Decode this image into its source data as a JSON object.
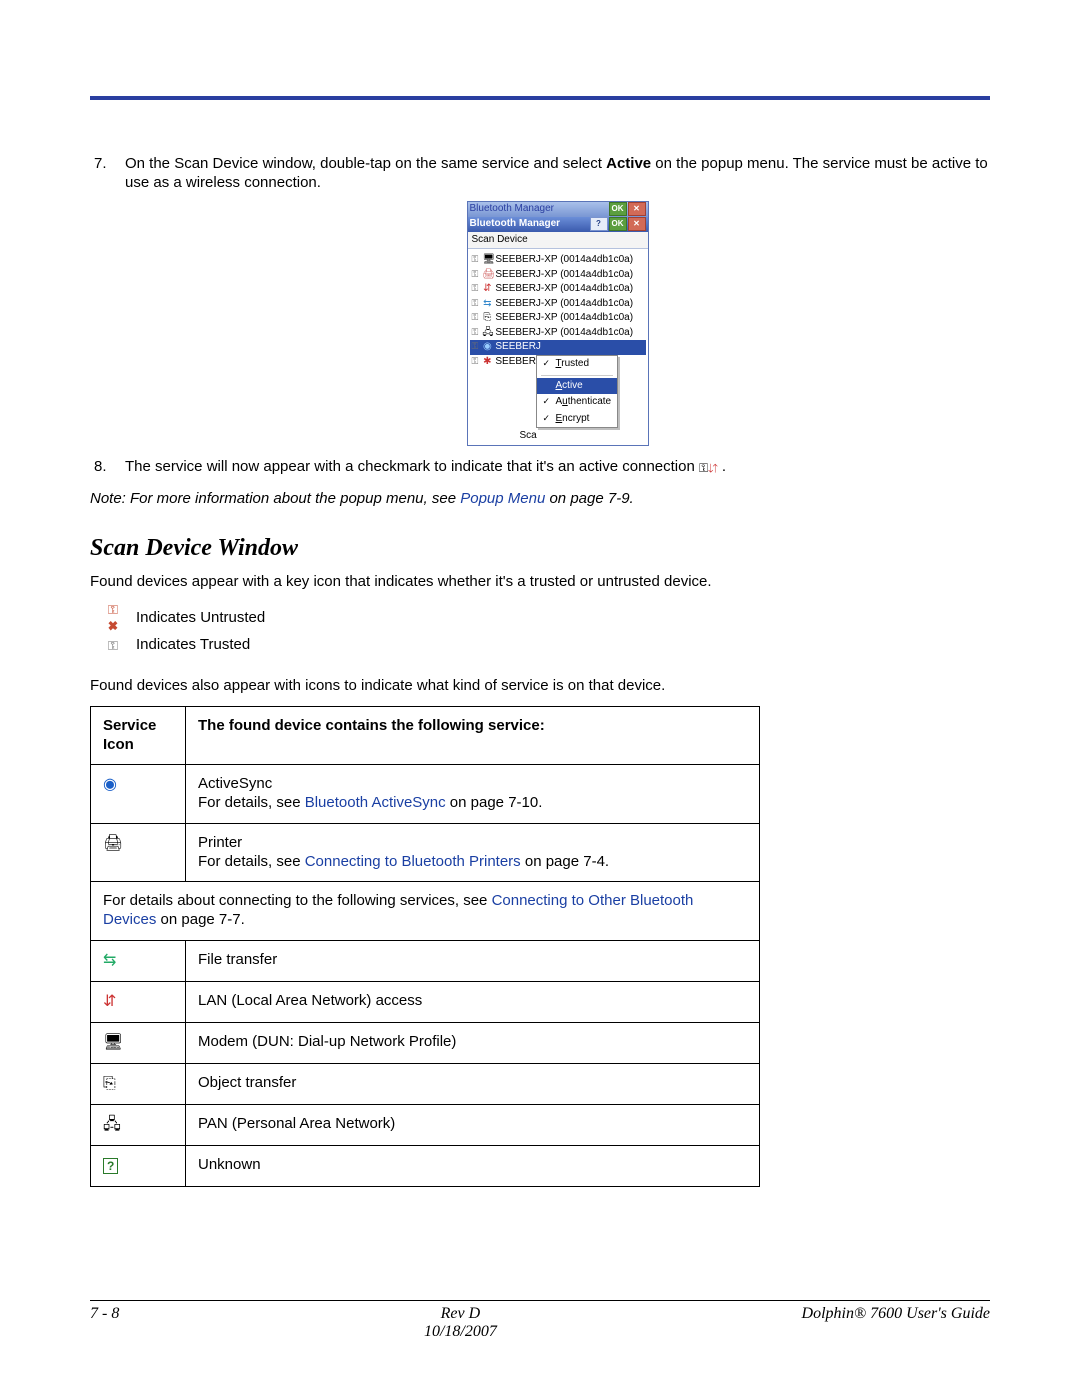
{
  "steps": {
    "s7_a": "On the Scan Device window, double-tap on the same service and select ",
    "s7_b": " on the popup menu. The service must be active to use as a wireless connection.",
    "s7_strong": "Active",
    "s8_a": "The service will now appear with a checkmark to indicate that it's an active connection ",
    "s8_b": " ."
  },
  "bt": {
    "title1": "Bluetooth  Manager",
    "ok_small": "OK",
    "title2": "Bluetooth Manager",
    "help": "?",
    "ok": "OK",
    "close": "✕",
    "tab": "Scan Device",
    "dev": "SEEBERJ-XP (0014a4db1c0a)",
    "dev_short": "SEEBERJ",
    "menu": {
      "trusted": "Trusted",
      "active": "Active",
      "auth": "Authenticate",
      "encrypt": "Encrypt"
    },
    "sca": "Sca"
  },
  "note": {
    "lead": "Note:   For more information about the popup menu, see ",
    "link": "Popup Menu",
    "tail": " on page 7-9."
  },
  "section_title": "Scan Device Window",
  "p1": "Found devices appear with a key icon that indicates whether it's a trusted or untrusted device.",
  "legend": {
    "untrusted": "Indicates Untrusted",
    "trusted": "Indicates Trusted"
  },
  "p2": "Found devices also appear with icons to indicate what kind of service is on that device.",
  "table": {
    "h1": "Service Icon",
    "h2": "The found device contains the following service:",
    "r_active_a": "ActiveSync",
    "r_active_b": "For details, see ",
    "r_active_link": "Bluetooth ActiveSync",
    "r_active_c": " on page 7-10.",
    "r_printer_a": "Printer",
    "r_printer_b": "For details, see ",
    "r_printer_link": "Connecting to Bluetooth Printers",
    "r_printer_c": " on page 7-4.",
    "r_connect_a": "For details about connecting to the following services, see ",
    "r_connect_link": "Connecting to Other Bluetooth Devices",
    "r_connect_b": " on page 7-7.",
    "r_ft": "File transfer",
    "r_lan": "LAN (Local Area Network) access",
    "r_modem": "Modem (DUN: Dial-up Network Profile)",
    "r_obj": "Object transfer",
    "r_pan": "PAN (Personal Area Network)",
    "r_unk": "Unknown"
  },
  "footer": {
    "left": "7 - 8",
    "mid1": "Rev D",
    "mid2": "10/18/2007",
    "right": "Dolphin® 7600 User's Guide"
  }
}
